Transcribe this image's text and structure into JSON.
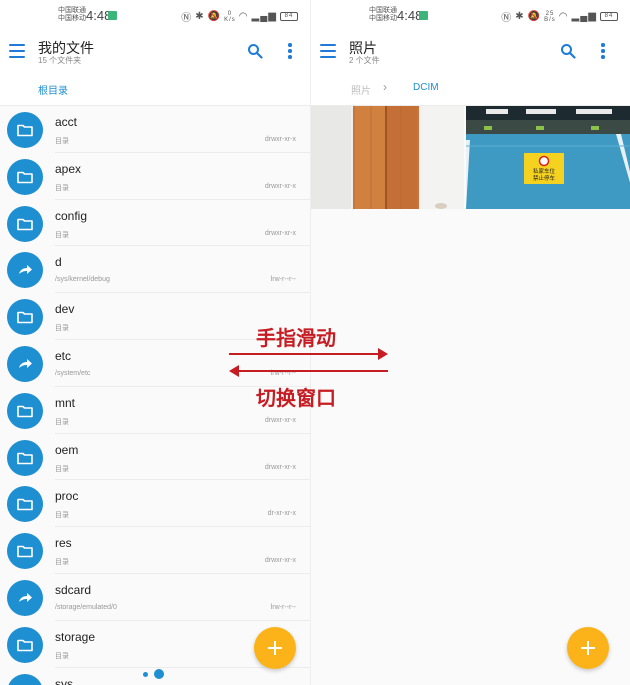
{
  "left": {
    "status": {
      "carrier_1": "中国联通",
      "carrier_2": "中国移动",
      "time": "4:48",
      "speed": "0",
      "speed_unit": "K/s",
      "battery": "84"
    },
    "appbar": {
      "title": "我的文件",
      "subtitle": "15 个文件夹"
    },
    "breadcrumb": [
      "根目录"
    ],
    "files": [
      {
        "name": "acct",
        "desc": "目录",
        "perm": "drwxr-xr-x",
        "kind": "folder"
      },
      {
        "name": "apex",
        "desc": "目录",
        "perm": "drwxr-xr-x",
        "kind": "folder"
      },
      {
        "name": "config",
        "desc": "目录",
        "perm": "drwxr-xr-x",
        "kind": "folder"
      },
      {
        "name": "d",
        "desc": "/sys/kernel/debug",
        "perm": "lrw-r--r--",
        "kind": "link"
      },
      {
        "name": "dev",
        "desc": "目录",
        "perm": "",
        "kind": "folder"
      },
      {
        "name": "etc",
        "desc": "/system/etc",
        "perm": "lrw-r--r--",
        "kind": "link"
      },
      {
        "name": "mnt",
        "desc": "目录",
        "perm": "drwxr-xr-x",
        "kind": "folder"
      },
      {
        "name": "oem",
        "desc": "目录",
        "perm": "drwxr-xr-x",
        "kind": "folder"
      },
      {
        "name": "proc",
        "desc": "目录",
        "perm": "dr-xr-xr-x",
        "kind": "folder"
      },
      {
        "name": "res",
        "desc": "目录",
        "perm": "drwxr-xr-x",
        "kind": "folder"
      },
      {
        "name": "sdcard",
        "desc": "/storage/emulated/0",
        "perm": "lrw-r--r--",
        "kind": "link"
      },
      {
        "name": "storage",
        "desc": "目录",
        "perm": "",
        "kind": "folder"
      },
      {
        "name": "sys",
        "desc": "",
        "perm": "",
        "kind": "folder"
      }
    ]
  },
  "right": {
    "status": {
      "carrier_1": "中国联通",
      "carrier_2": "中国移动",
      "time": "4:48",
      "speed": "25",
      "speed_unit": "B/s",
      "battery": "84"
    },
    "appbar": {
      "title": "照片",
      "subtitle": "2 个文件"
    },
    "breadcrumb": [
      "照片",
      "DCIM"
    ],
    "photo_sign": {
      "line1": "私家车位",
      "line2": "禁止停车"
    }
  },
  "annotation": {
    "line1": "手指滑动",
    "line2": "切换窗口"
  },
  "colors": {
    "accent": "#1e8fd1",
    "fab": "#fcb31a",
    "annotation": "#c61d23"
  }
}
